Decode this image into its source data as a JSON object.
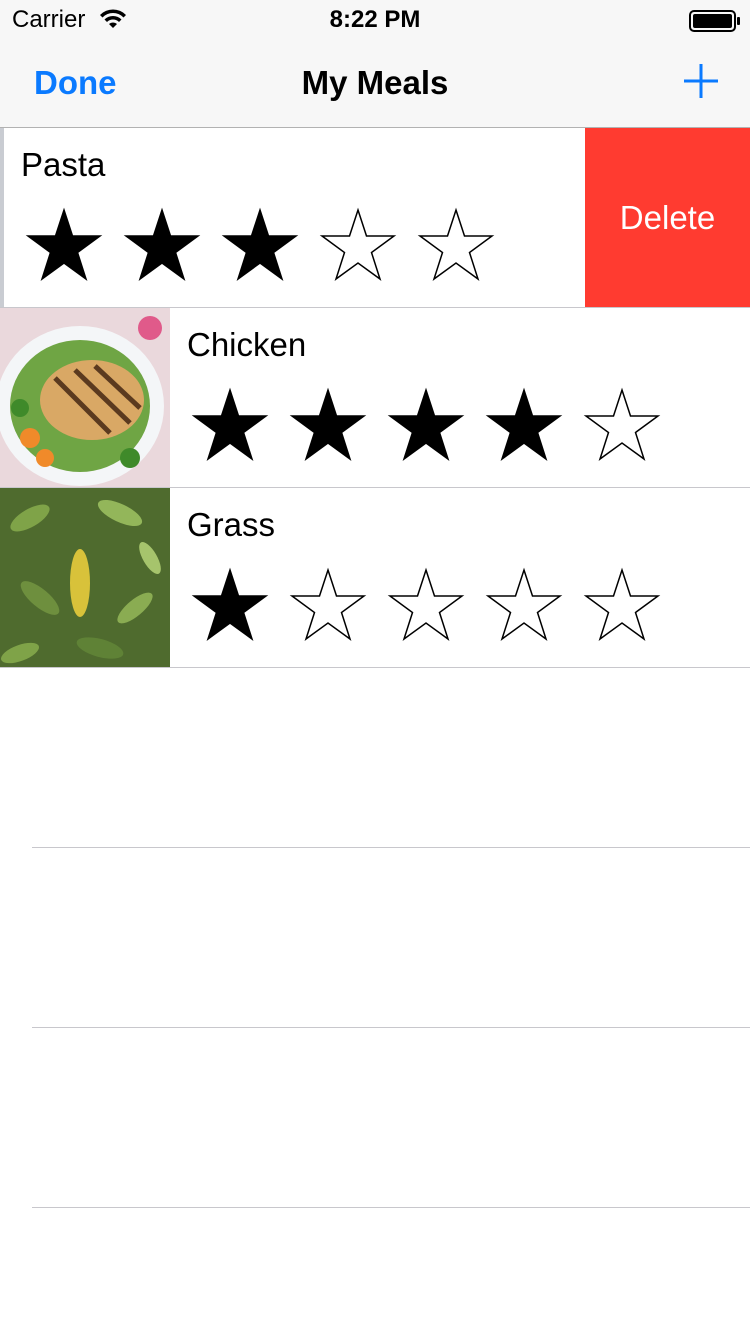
{
  "status_bar": {
    "carrier": "Carrier",
    "time": "8:22 PM"
  },
  "nav": {
    "done_label": "Done",
    "title": "My Meals",
    "add_icon": "plus-icon"
  },
  "colors": {
    "tint": "#0a7aff",
    "delete": "#ff3b30"
  },
  "meals": [
    {
      "name": "Pasta",
      "rating": 3,
      "max_rating": 5,
      "photo": "pasta-photo",
      "swiped": true
    },
    {
      "name": "Chicken",
      "rating": 4,
      "max_rating": 5,
      "photo": "chicken-photo",
      "swiped": false
    },
    {
      "name": "Grass",
      "rating": 1,
      "max_rating": 5,
      "photo": "grass-photo",
      "swiped": false
    }
  ],
  "swipe_action": {
    "label": "Delete"
  }
}
